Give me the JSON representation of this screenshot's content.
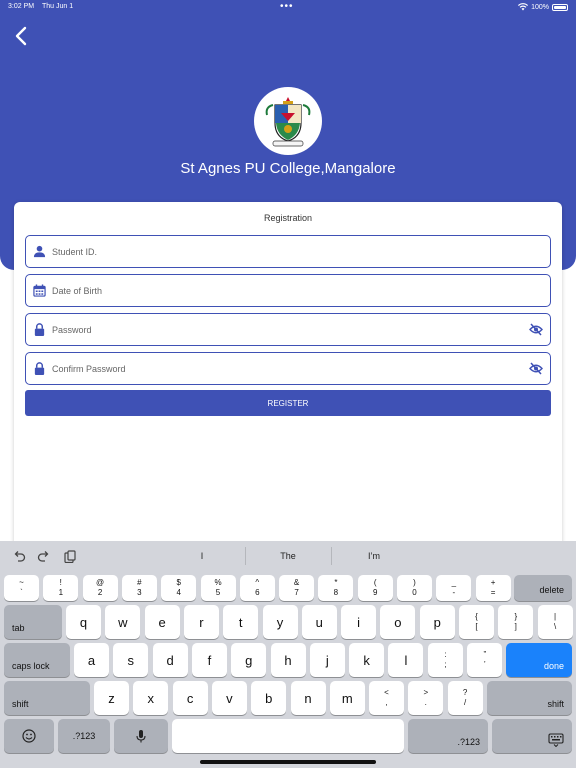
{
  "status": {
    "time": "3:02 PM",
    "date": "Thu Jun 1",
    "battery": "100%"
  },
  "header": {
    "college_name": "St Agnes PU College,Mangalore",
    "brand_color": "#3f51b5"
  },
  "form": {
    "title": "Registration",
    "student_id_placeholder": "Student ID.",
    "dob_placeholder": "Date of Birth",
    "password_placeholder": "Password",
    "confirm_password_placeholder": "Confirm Password",
    "register_label": "REGISTER"
  },
  "keyboard": {
    "suggestions": [
      "I",
      "The",
      "I’m"
    ],
    "row1": [
      [
        "~",
        "`"
      ],
      [
        "!",
        "1"
      ],
      [
        "@",
        "2"
      ],
      [
        "#",
        "3"
      ],
      [
        "$",
        "4"
      ],
      [
        "%",
        "5"
      ],
      [
        "^",
        "6"
      ],
      [
        "&",
        "7"
      ],
      [
        "*",
        "8"
      ],
      [
        "(",
        "9"
      ],
      [
        ")",
        "0"
      ],
      [
        "_",
        "-"
      ],
      [
        "+",
        "="
      ]
    ],
    "row2": [
      "q",
      "w",
      "e",
      "r",
      "t",
      "y",
      "u",
      "i",
      "o",
      "p"
    ],
    "row2_extra": [
      [
        "{",
        "["
      ],
      [
        "}",
        "]"
      ],
      [
        "|",
        "\\"
      ]
    ],
    "row3": [
      "a",
      "s",
      "d",
      "f",
      "g",
      "h",
      "j",
      "k",
      "l"
    ],
    "row3_extra": [
      [
        ":",
        ";"
      ],
      [
        "”",
        "’"
      ]
    ],
    "row4": [
      "z",
      "x",
      "c",
      "v",
      "b",
      "n",
      "m"
    ],
    "row4_extra": [
      [
        "<",
        ","
      ],
      [
        ">",
        "."
      ],
      [
        "?",
        "/"
      ]
    ],
    "delete_label": "delete",
    "tab_label": "tab",
    "caps_label": "caps lock",
    "done_label": "done",
    "shift_label": "shift",
    "numbers_label": ".?123"
  }
}
